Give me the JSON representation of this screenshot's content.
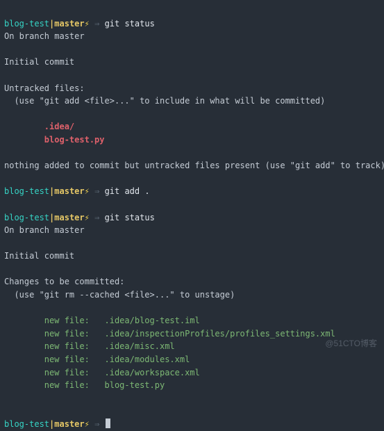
{
  "prompt": {
    "dir": "blog-test",
    "sep": "|",
    "branch": "master",
    "lightning": "⚡",
    "arrow": "⇒"
  },
  "cmds": {
    "status1": "git status",
    "add": "git add .",
    "status2": "git status"
  },
  "out": {
    "on_branch": "On branch master",
    "initial_commit": "Initial commit",
    "untracked_header": "Untracked files:",
    "untracked_hint": "  (use \"git add <file>...\" to include in what will be committed)",
    "untracked_file1": "        .idea/",
    "untracked_file2": "        blog-test.py",
    "nothing_added": "nothing added to commit but untracked files present (use \"git add\" to track)",
    "changes_header": "Changes to be committed:",
    "unstage_hint": "  (use \"git rm --cached <file>...\" to unstage)",
    "new_files": [
      "        new file:   .idea/blog-test.iml",
      "        new file:   .idea/inspectionProfiles/profiles_settings.xml",
      "        new file:   .idea/misc.xml",
      "        new file:   .idea/modules.xml",
      "        new file:   .idea/workspace.xml",
      "        new file:   blog-test.py"
    ]
  },
  "watermark": "@51CTO博客"
}
